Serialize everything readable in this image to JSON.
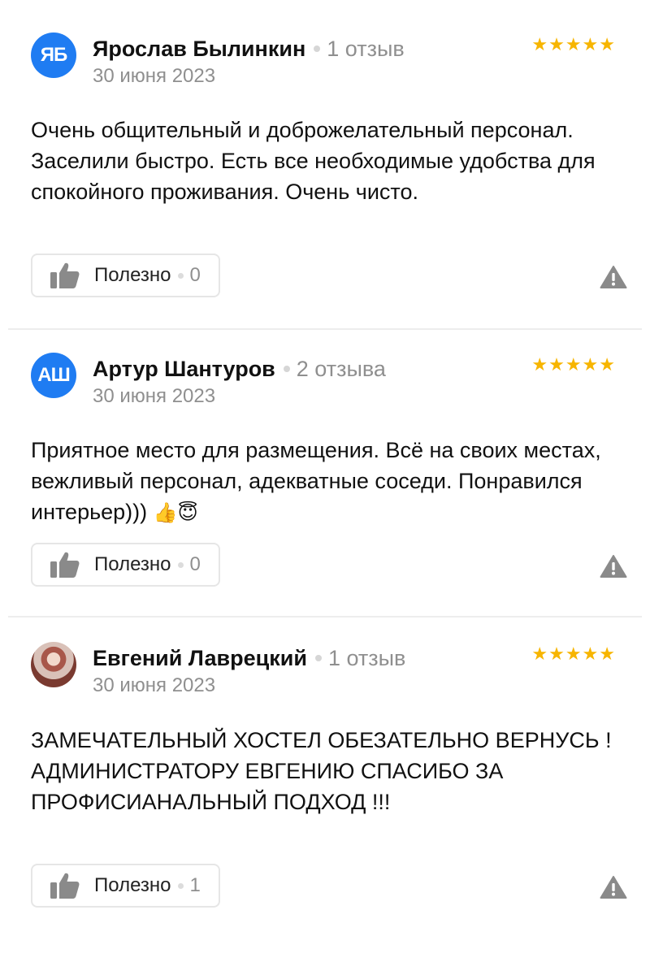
{
  "reviews": [
    {
      "avatar_initials": "ЯБ",
      "author": "Ярослав Былинкин",
      "review_count": "1 отзыв",
      "date": "30 июня 2023",
      "stars": "★★★★★",
      "text": "Очень общительный и доброжелательный персонал. Заселили быстро. Есть все необходимые удобства для спокойного проживания. Очень чисто.",
      "useful_label": "Полезно",
      "useful_count": "0"
    },
    {
      "avatar_initials": "АШ",
      "author": "Артур Шантуров",
      "review_count": "2 отзыва",
      "date": "30 июня 2023",
      "stars": "★★★★★",
      "text": "Приятное место для размещения. Всё на своих местах, вежливый персонал, адекватные соседи. Понравился интерьер)))",
      "emoji": "👍😇",
      "useful_label": "Полезно",
      "useful_count": "0"
    },
    {
      "author": "Евгений Лаврецкий",
      "review_count": "1 отзыв",
      "date": "30 июня 2023",
      "stars": "★★★★★",
      "text": "ЗАМЕЧАТЕЛЬНЫЙ ХОСТЕЛ ОБЕЗАТЕЛЬНО ВЕРНУСЬ !АДМИНИСТРАТОРУ ЕВГЕНИЮ СПАСИБО ЗА ПРОФИСИАНАЛЬНЫЙ ПОДХОД !!!",
      "useful_label": "Полезно",
      "useful_count": "1"
    }
  ],
  "icons": {
    "thumb": "thumbs-up-icon",
    "report": "warning-triangle-icon",
    "star": "star-icon"
  },
  "colors": {
    "avatar_blue": "#1f7cf2",
    "star_yellow": "#f7b500",
    "muted_text": "#8f8f8f",
    "icon_gray": "#8a8a8a"
  }
}
